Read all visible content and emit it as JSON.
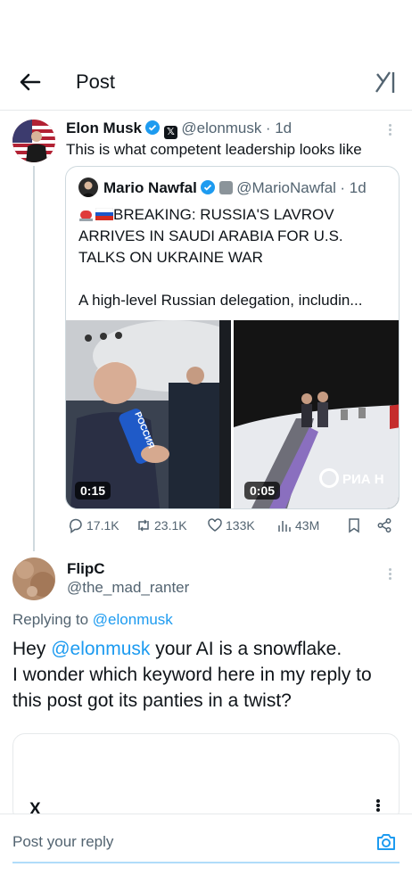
{
  "header": {
    "title": "Post"
  },
  "main_post": {
    "name": "Elon Musk",
    "handle": "@elonmusk",
    "time": "· 1d",
    "text": "This is what competent leadership looks like"
  },
  "quoted_post": {
    "name": "Mario Nawfal",
    "handle": "@MarioNawfal",
    "time": "· 1d",
    "text_line1": "BREAKING: RUSSIA'S LAVROV",
    "text_line2": "ARRIVES IN SAUDI ARABIA FOR U.S.",
    "text_line3": "TALKS ON UKRAINE WAR",
    "text_line4": "A high-level Russian delegation, includin...",
    "media": [
      {
        "duration": "0:15",
        "mic_label": "РОССИЯ"
      },
      {
        "duration": "0:05",
        "watermark": "РИА Н"
      }
    ]
  },
  "actions": {
    "replies": "17.1K",
    "reposts": "23.1K",
    "likes": "133K",
    "views": "43M"
  },
  "reply": {
    "name": "FlipC",
    "handle": "@the_mad_ranter",
    "replying_label": "Replying to",
    "replying_to": "@elonmusk",
    "text_hey": "Hey",
    "text_mention": "@elonmusk",
    "text_line1_rest": "your AI is a snowflake.",
    "text_line2": "I wonder which keyword here in my reply to",
    "text_line3": "this post got its panties in a twist?"
  },
  "embedded_card": {
    "partial_text": "X"
  },
  "composer": {
    "placeholder": "Post your reply"
  },
  "colors": {
    "accent": "#1d9bf0",
    "text": "#0f1419",
    "secondary": "#536471",
    "border": "#cfd9de"
  }
}
